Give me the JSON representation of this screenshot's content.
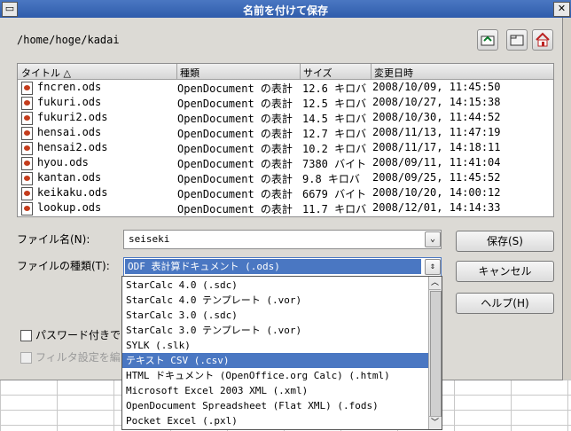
{
  "window": {
    "title": "名前を付けて保存",
    "close_glyph": "✕"
  },
  "path": "/home/hoge/kadai",
  "toolbar": {
    "icons": [
      "folder-up-icon",
      "new-folder-icon",
      "home-icon"
    ]
  },
  "file_list": {
    "columns": [
      "タイトル △",
      "種類",
      "サイズ",
      "変更日時"
    ],
    "rows": [
      {
        "name": "fncren.ods",
        "type": "OpenDocument の表計",
        "size": "12.6 キロバ",
        "date": "2008/10/09, 11:45:50"
      },
      {
        "name": "fukuri.ods",
        "type": "OpenDocument の表計",
        "size": "12.5 キロバ",
        "date": "2008/10/27, 14:15:38"
      },
      {
        "name": "fukuri2.ods",
        "type": "OpenDocument の表計",
        "size": "14.5 キロバ",
        "date": "2008/10/30, 11:44:52"
      },
      {
        "name": "hensai.ods",
        "type": "OpenDocument の表計",
        "size": "12.7 キロバ",
        "date": "2008/11/13, 11:47:19"
      },
      {
        "name": "hensai2.ods",
        "type": "OpenDocument の表計",
        "size": "10.2 キロバ",
        "date": "2008/11/17, 14:18:11"
      },
      {
        "name": "hyou.ods",
        "type": "OpenDocument の表計",
        "size": "7380 バイト",
        "date": "2008/09/11, 11:41:04"
      },
      {
        "name": "kantan.ods",
        "type": "OpenDocument の表計",
        "size": "9.8 キロバ",
        "date": "2008/09/25, 11:45:52"
      },
      {
        "name": "keikaku.ods",
        "type": "OpenDocument の表計",
        "size": "6679 バイト",
        "date": "2008/10/20, 14:00:12"
      },
      {
        "name": "lookup.ods",
        "type": "OpenDocument の表計",
        "size": "11.7 キロバ",
        "date": "2008/12/01, 14:14:33"
      }
    ]
  },
  "filename": {
    "label": "ファイル名(N):",
    "value": "seiseki"
  },
  "filetype": {
    "label": "ファイルの種類(T):",
    "selected": "ODF 表計算ドキュメント (.ods)",
    "options": [
      "StarCalc 4.0 (.sdc)",
      "StarCalc 4.0 テンプレート (.vor)",
      "StarCalc 3.0 (.sdc)",
      "StarCalc 3.0 テンプレート (.vor)",
      "SYLK (.slk)",
      "テキスト CSV (.csv)",
      "HTML ドキュメント (OpenOffice.org Calc) (.html)",
      "Microsoft Excel 2003 XML (.xml)",
      "OpenDocument Spreadsheet (Flat XML) (.fods)",
      "Pocket Excel (.pxl)"
    ],
    "highlighted": "テキスト CSV (.csv)"
  },
  "buttons": {
    "save": "保存(S)",
    "cancel": "キャンセル",
    "help": "ヘルプ(H)"
  },
  "options": {
    "password": "パスワード付きで",
    "filter": "フィルタ設定を編"
  },
  "colors": {
    "titlebar": "#3a68b8",
    "selection": "#4a77c2"
  }
}
